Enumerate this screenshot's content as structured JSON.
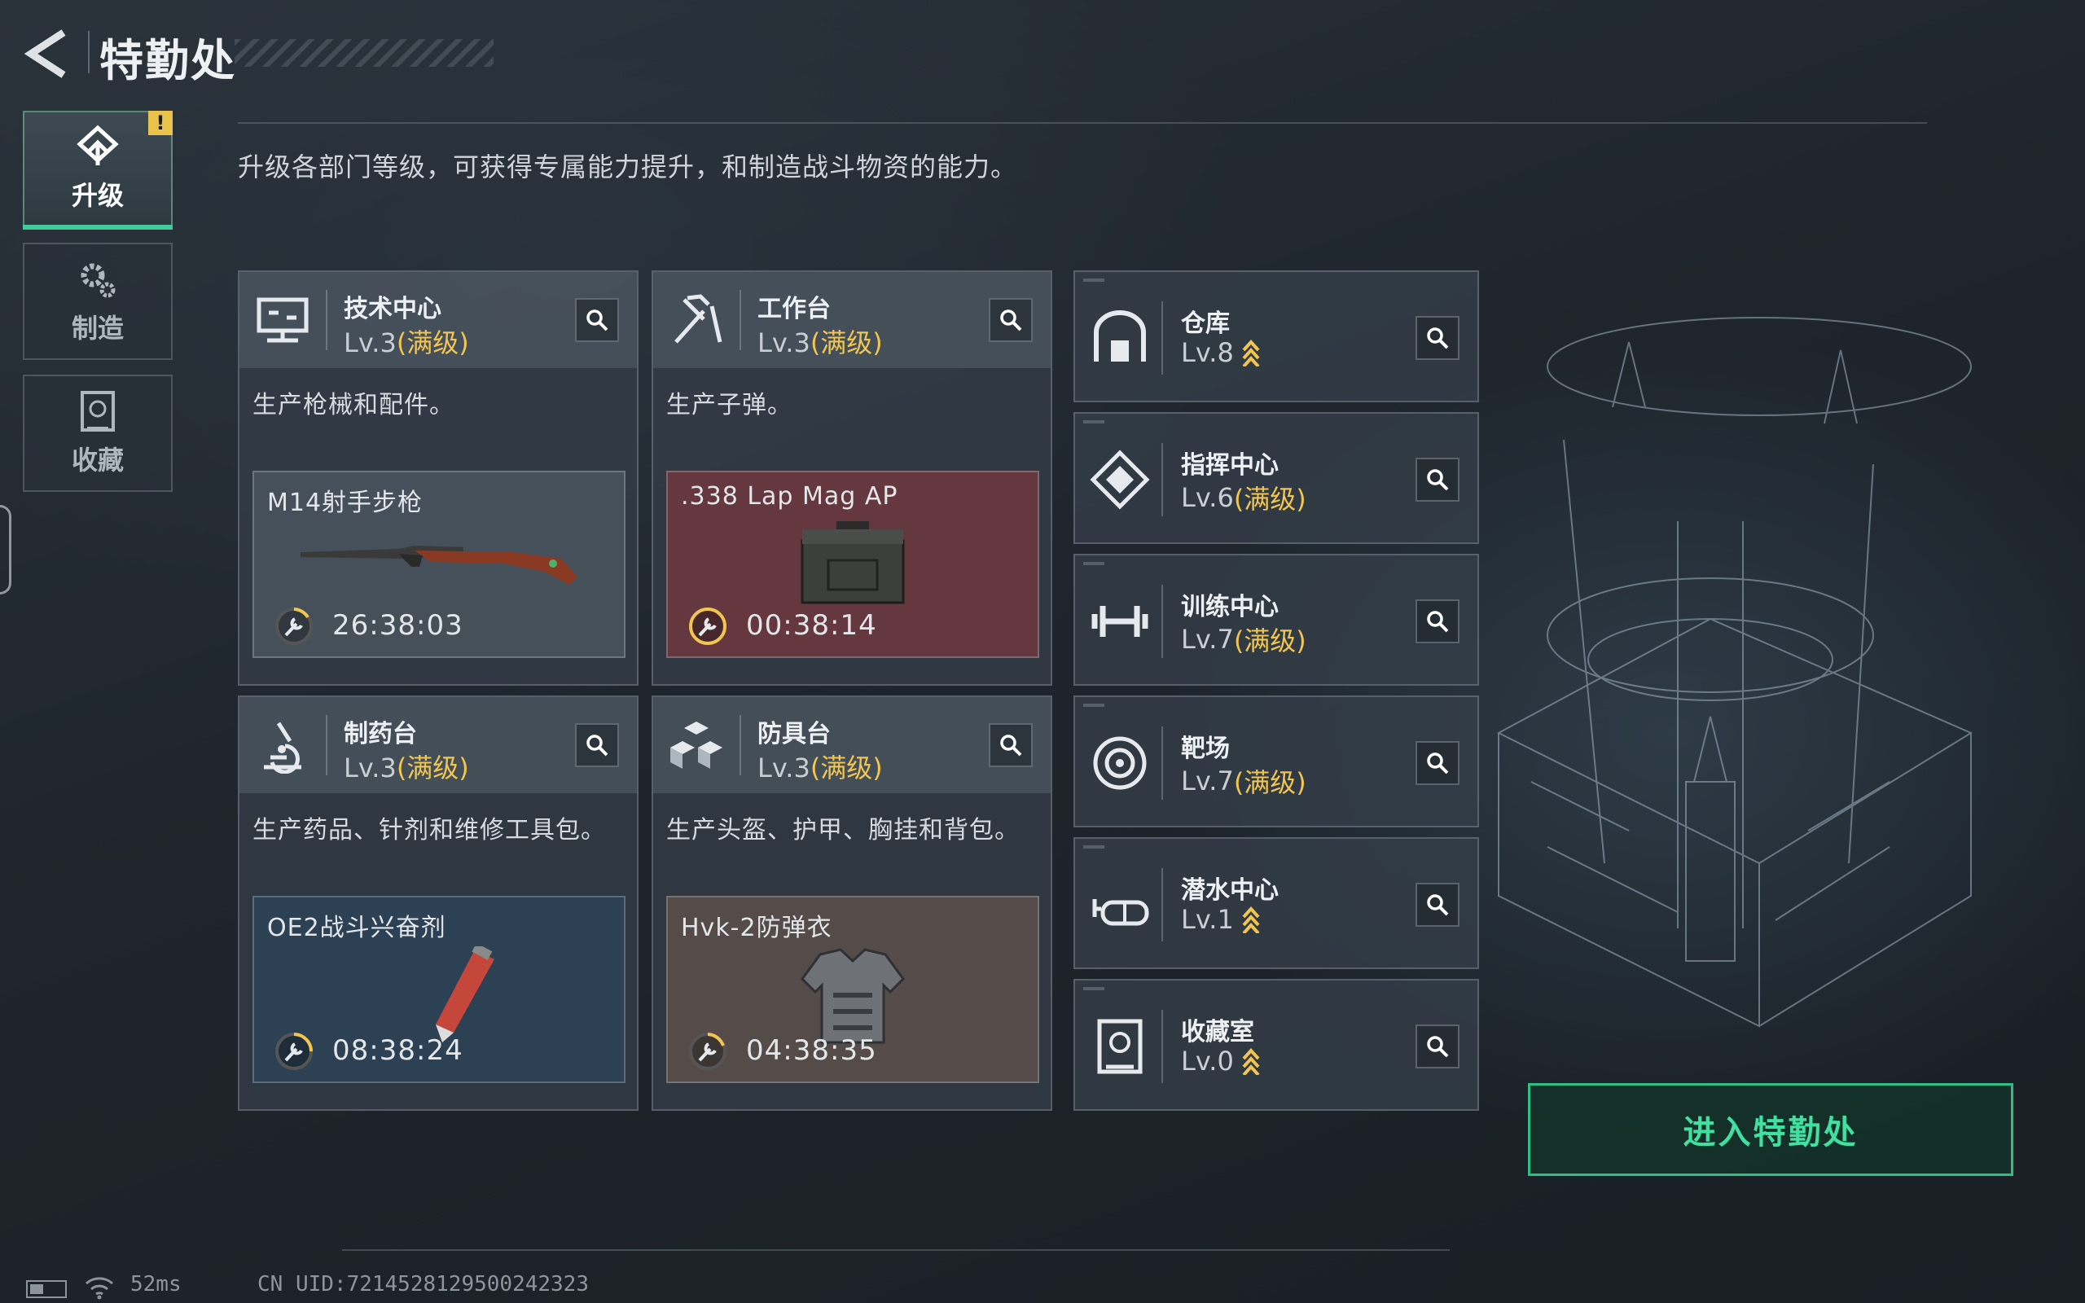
{
  "header": {
    "title": "特勤处"
  },
  "tabs": [
    {
      "label": "升级",
      "icon": "upgrade-icon",
      "active": true,
      "badge": "!"
    },
    {
      "label": "制造",
      "icon": "gears-icon",
      "active": false
    },
    {
      "label": "收藏",
      "icon": "collection-icon",
      "active": false
    }
  ],
  "description": "升级各部门等级，可获得专属能力提升，和制造战斗物资的能力。",
  "facilities": [
    {
      "name": "技术中心",
      "level": "Lv.3",
      "status": "(满级)",
      "desc": "生产枪械和配件。",
      "craft": {
        "name": "M14射手步枪",
        "timer": "26:38:03",
        "image": "rifle-icon"
      }
    },
    {
      "name": "工作台",
      "level": "Lv.3",
      "status": "(满级)",
      "desc": "生产子弹。",
      "craft": {
        "name": ".338 Lap Mag AP",
        "timer": "00:38:14",
        "image": "ammo-box-icon"
      }
    },
    {
      "name": "制药台",
      "level": "Lv.3",
      "status": "(满级)",
      "desc": "生产药品、针剂和维修工具包。",
      "craft": {
        "name": "OE2战斗兴奋剂",
        "timer": "08:38:24",
        "image": "injector-icon"
      }
    },
    {
      "name": "防具台",
      "level": "Lv.3",
      "status": "(满级)",
      "desc": "生产头盔、护甲、胸挂和背包。",
      "craft": {
        "name": "Hvk-2防弹衣",
        "timer": "04:38:35",
        "image": "body-armor-icon"
      }
    }
  ],
  "side_facilities": [
    {
      "name": "仓库",
      "level": "Lv.8",
      "status": "",
      "upgradable": true
    },
    {
      "name": "指挥中心",
      "level": "Lv.6",
      "status": "(满级)",
      "upgradable": false
    },
    {
      "name": "训练中心",
      "level": "Lv.7",
      "status": "(满级)",
      "upgradable": false
    },
    {
      "name": "靶场",
      "level": "Lv.7",
      "status": "(满级)",
      "upgradable": false
    },
    {
      "name": "潜水中心",
      "level": "Lv.1",
      "status": "",
      "upgradable": true
    },
    {
      "name": "收藏室",
      "level": "Lv.0",
      "status": "",
      "upgradable": true
    }
  ],
  "enter_button": "进入特勤处",
  "status_bar": {
    "ping": "52ms",
    "uid": "CN UID:7214528129500242323"
  },
  "colors": {
    "accent": "#43c99a",
    "maxed": "#f1c550",
    "enter": "#3fe0a0"
  }
}
